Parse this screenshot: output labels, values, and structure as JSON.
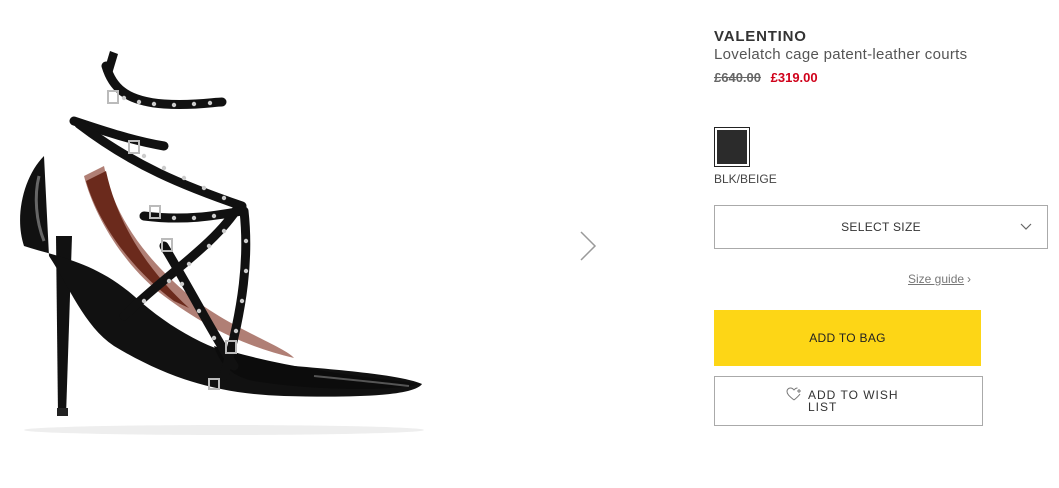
{
  "product": {
    "brand": "VALENTINO",
    "name": "Lovelatch cage patent-leather courts",
    "old_price": "£640.00",
    "new_price": "£319.00"
  },
  "colour": {
    "label": "BLK/BEIGE",
    "swatch_color": "#2b2b2b"
  },
  "size_select": {
    "label": "SELECT SIZE"
  },
  "size_guide": {
    "label": "Size guide",
    "arrow": "›"
  },
  "actions": {
    "add_to_bag": "ADD TO BAG",
    "add_to_wishlist": "ADD TO WISH LIST"
  },
  "colors": {
    "accent_yellow": "#fdd616",
    "sale_red": "#d0021b"
  },
  "icons": {
    "gallery_next": "chevron-right-icon",
    "select_dropdown": "chevron-down-icon",
    "wishlist": "heart-plus-icon"
  }
}
